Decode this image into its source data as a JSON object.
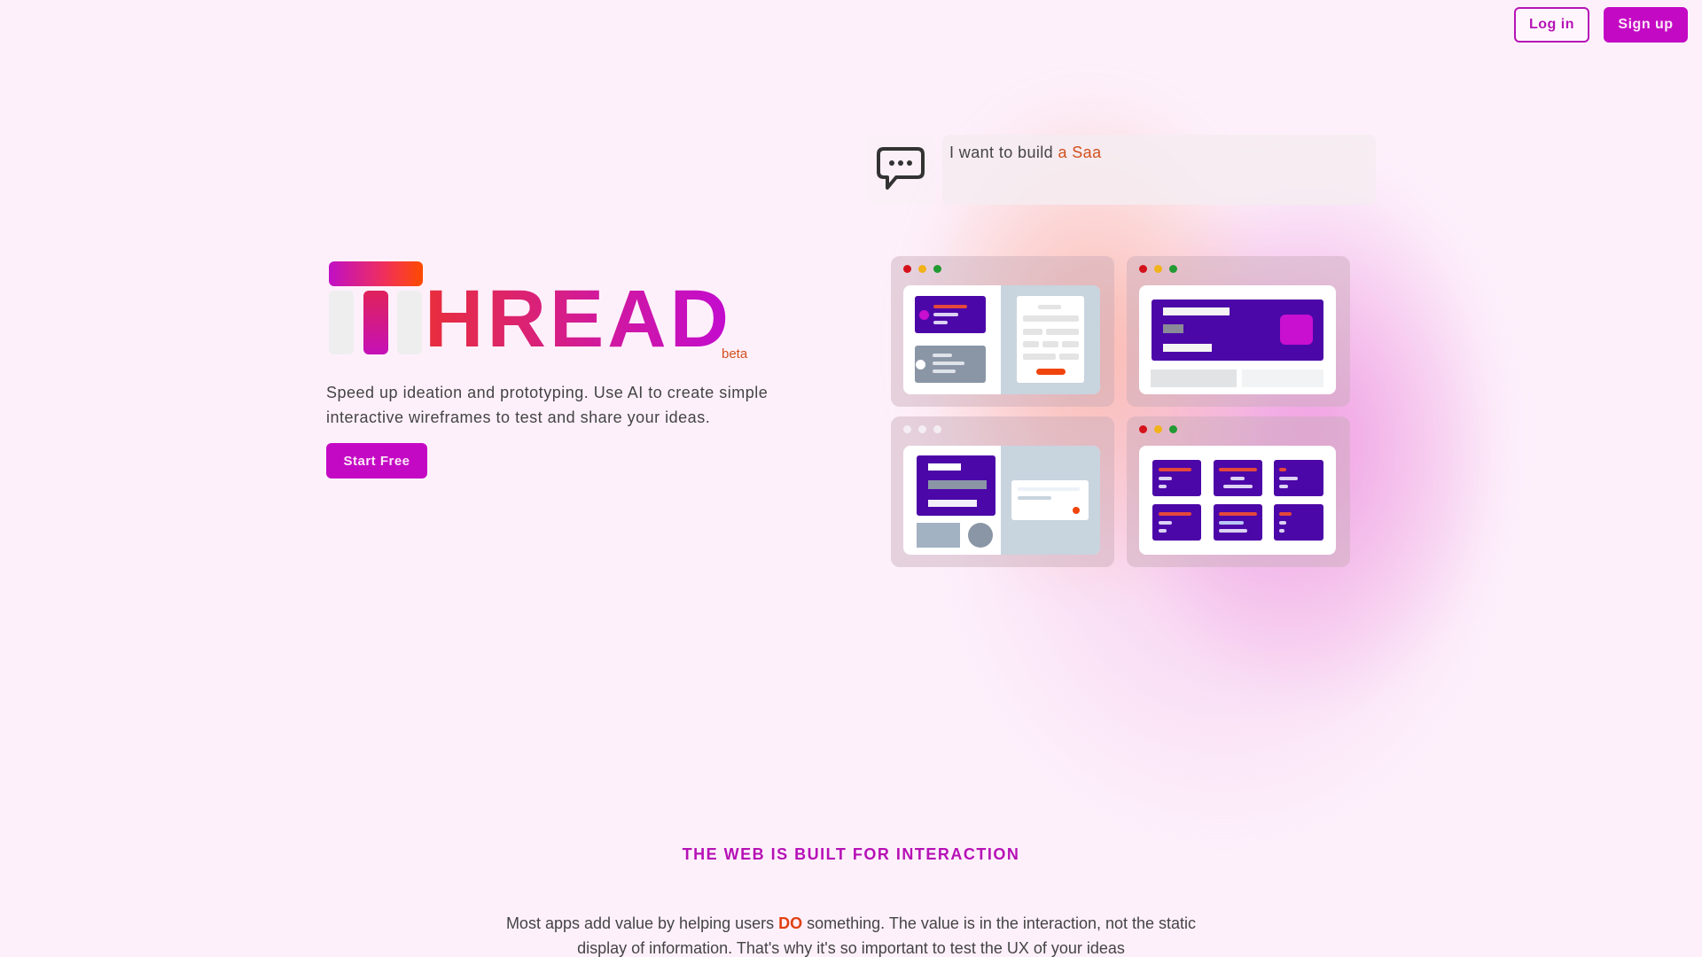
{
  "header": {
    "login_label": "Log in",
    "signup_label": "Sign up"
  },
  "hero": {
    "logo_text": "HREAD",
    "logo_badge": "beta",
    "tagline": "Speed up ideation and prototyping. Use AI to create simple interactive wireframes to test and share your ideas.",
    "cta_label": "Start Free"
  },
  "prompt": {
    "icon": "chat-bubble-dots-icon",
    "static_text": "I want to build ",
    "typed_text": "a Saa"
  },
  "previews": [
    {
      "name": "preview-split-cards",
      "dots": [
        "red",
        "yellow",
        "green"
      ]
    },
    {
      "name": "preview-hero-card",
      "dots": [
        "red",
        "yellow",
        "green"
      ]
    },
    {
      "name": "preview-form-card",
      "dots": [
        "white",
        "white",
        "white"
      ]
    },
    {
      "name": "preview-grid-cards",
      "dots": [
        "red",
        "yellow",
        "green"
      ]
    }
  ],
  "section": {
    "title": "THE WEB IS BUILT FOR INTERACTION",
    "body_before": "Most apps add value by helping users ",
    "body_emphasis": "DO",
    "body_after": " something. The value is in the interaction, not the static display of information. That's why it's so important to test the UX of your ideas"
  },
  "colors": {
    "brand_magenta": "#c409c4",
    "accent_orange": "#d2501d",
    "wireframe_purple": "#4c07a8"
  }
}
